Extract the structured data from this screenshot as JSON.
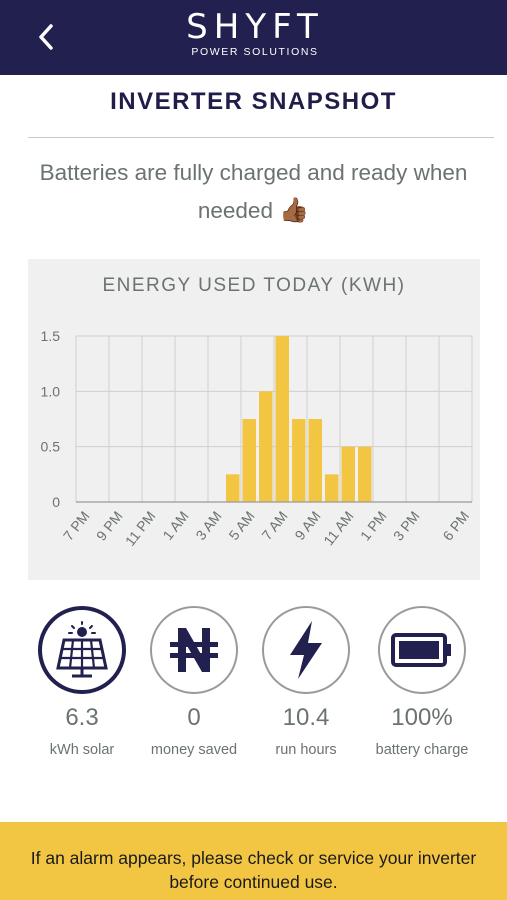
{
  "header": {
    "back_icon": "chevron-left-icon",
    "logo_word": "SHYFT",
    "logo_sub": "POWER SOLUTIONS"
  },
  "page": {
    "title": "INVERTER SNAPSHOT",
    "status_message": "Batteries are fully charged and ready when needed",
    "status_emoji": "👍🏾"
  },
  "chart_data": {
    "type": "bar",
    "title": "ENERGY USED TODAY (KWH)",
    "xlabel": "",
    "ylabel": "",
    "ylim": [
      0,
      1.5
    ],
    "yticks": [
      "0",
      "0.5",
      "1.0",
      "1.5"
    ],
    "tick_labels": [
      "7 PM",
      "9 PM",
      "11 PM",
      "1 AM",
      "3 AM",
      "5 AM",
      "7 AM",
      "9 AM",
      "11 AM",
      "1 PM",
      "3 PM",
      "6 PM"
    ],
    "categories": [
      "7 PM",
      "8 PM",
      "9 PM",
      "10 PM",
      "11 PM",
      "12 AM",
      "1 AM",
      "2 AM",
      "3 AM",
      "4 AM",
      "5 AM",
      "6 AM",
      "7 AM",
      "8 AM",
      "9 AM",
      "10 AM",
      "11 AM",
      "12 PM",
      "1 PM",
      "2 PM",
      "3 PM",
      "4 PM",
      "5 PM",
      "6 PM"
    ],
    "values": [
      0,
      0,
      0,
      0,
      0,
      0,
      0,
      0,
      0,
      0.25,
      0.75,
      1.0,
      1.5,
      0.75,
      0.75,
      0.25,
      0.5,
      0.5,
      0,
      0,
      0,
      0,
      0,
      0
    ],
    "grid": true,
    "bar_color": "#f2c643"
  },
  "stats": [
    {
      "value": "6.3",
      "label": "kWh solar",
      "icon": "solar-panel-icon",
      "active": true
    },
    {
      "value": "0",
      "label": "money saved",
      "icon": "naira-icon",
      "active": false
    },
    {
      "value": "10.4",
      "label": "run hours",
      "icon": "lightning-icon",
      "active": false
    },
    {
      "value": "100%",
      "label": "battery charge",
      "icon": "battery-icon",
      "active": false
    }
  ],
  "alarm": {
    "text": "If an alarm appears, please check or service your inverter before continued use."
  },
  "colors": {
    "navy": "#22204f",
    "yellow": "#f2c643",
    "gray_text": "#6b7272"
  }
}
